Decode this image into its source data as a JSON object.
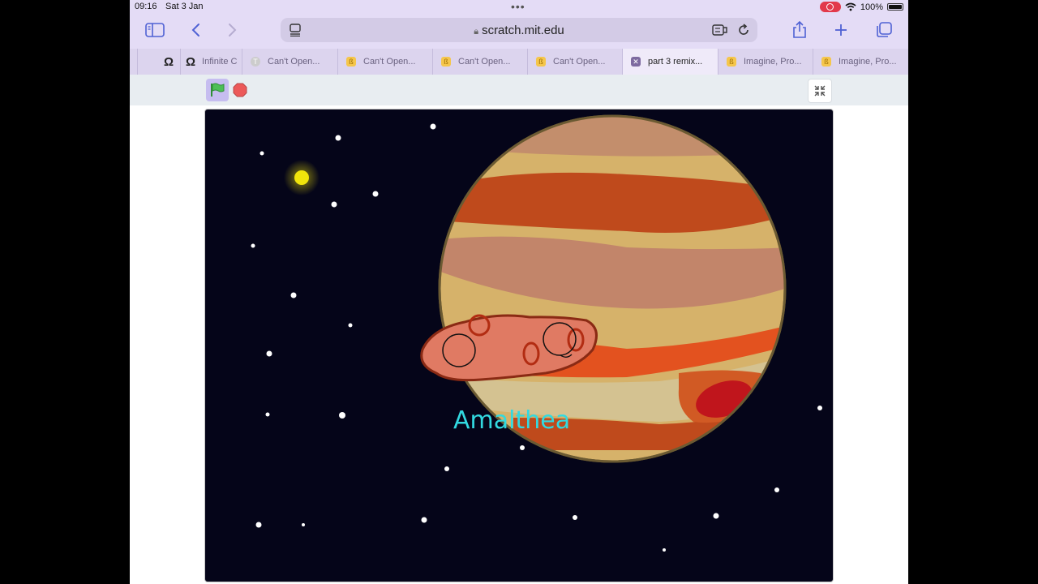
{
  "status": {
    "time": "09:16",
    "date": "Sat 3 Jan",
    "battery": "100%"
  },
  "browser": {
    "url": "scratch.mit.edu",
    "icons": [
      "sidebar-icon",
      "back-icon",
      "forward-icon",
      "reader-icon",
      "lock-icon",
      "translate-icon",
      "reload-icon",
      "share-icon",
      "plus-icon",
      "tabs-overview-icon"
    ]
  },
  "tabs": [
    {
      "label": "",
      "favicon": "omega"
    },
    {
      "label": "Infinite C",
      "favicon": "omega"
    },
    {
      "label": "Can't Open...",
      "favicon": "T"
    },
    {
      "label": "Can't Open...",
      "favicon": "scratch"
    },
    {
      "label": "Can't Open...",
      "favicon": "scratch"
    },
    {
      "label": "Can't Open...",
      "favicon": "scratch"
    },
    {
      "label": "part 3 remix...",
      "favicon": "close",
      "active": true
    },
    {
      "label": "Imagine, Pro...",
      "favicon": "scratch"
    },
    {
      "label": "Imagine, Pro...",
      "favicon": "scratch"
    }
  ],
  "stage": {
    "sprite_label": "Amalthea",
    "colors": {
      "space": "#050519",
      "label": "#32d9e0",
      "sun": "#f0e40c"
    }
  }
}
